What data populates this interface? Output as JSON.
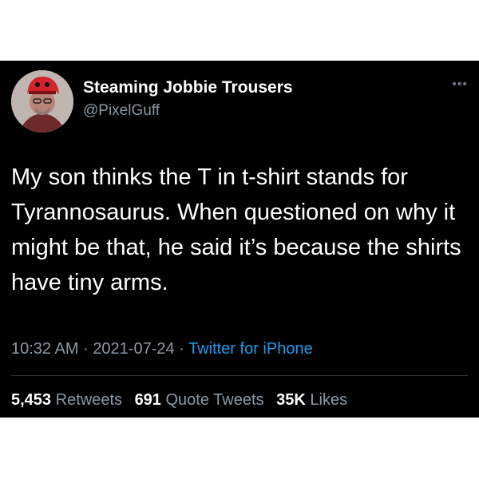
{
  "tweet": {
    "author": {
      "display_name": "Steaming Jobbie Trousers",
      "handle": "@PixelGuff",
      "avatar_icon": "avatar-image"
    },
    "more_icon": "more-options-icon",
    "text": "My son thinks the T in t-shirt stands for Tyrannosaurus. When questioned on why it might be that, he said it’s because the shirts have tiny arms.",
    "time": "10:32 AM",
    "separator": "·",
    "date": "2021-07-24",
    "source": "Twitter for iPhone",
    "stats": {
      "retweets_count": "5,453",
      "retweets_label": "Retweets",
      "quote_count": "691",
      "quote_label": "Quote Tweets",
      "likes_count": "35K",
      "likes_label": "Likes"
    },
    "colors": {
      "background": "#000000",
      "text": "#ffffff",
      "secondary": "#8b98a5",
      "link": "#1d9bf0"
    }
  }
}
